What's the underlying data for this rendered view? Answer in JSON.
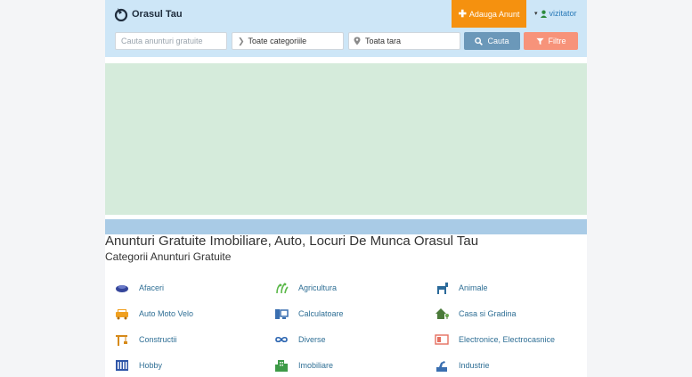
{
  "brand": {
    "name": "Orasul Tau"
  },
  "header": {
    "add_label": "Adauga Anunt",
    "user_label": "vizitator"
  },
  "search": {
    "placeholder": "Cauta anunturi gratuite",
    "category_value": "Toate categoriile",
    "location_value": "Toata tara",
    "search_label": "Cauta",
    "filter_label": "Filtre"
  },
  "main": {
    "title": "Anunturi Gratuite Imobiliare, Auto, Locuri De Munca Orasul Tau",
    "subtitle": "Categorii Anunturi Gratuite"
  },
  "categories": [
    {
      "label": "Afaceri",
      "icon": "business-icon",
      "color": "#34459a"
    },
    {
      "label": "Agricultura",
      "icon": "agriculture-icon",
      "color": "#5ab848"
    },
    {
      "label": "Animale",
      "icon": "animal-icon",
      "color": "#2b6a9a"
    },
    {
      "label": "Auto Moto Velo",
      "icon": "car-icon",
      "color": "#f0a020"
    },
    {
      "label": "Calculatoare",
      "icon": "computer-icon",
      "color": "#3a6fb0"
    },
    {
      "label": "Casa si Gradina",
      "icon": "house-icon",
      "color": "#4b7a3a"
    },
    {
      "label": "Constructii",
      "icon": "crane-icon",
      "color": "#d68a1a"
    },
    {
      "label": "Diverse",
      "icon": "infinity-icon",
      "color": "#2a64b0"
    },
    {
      "label": "Electronice, Electrocasnice",
      "icon": "appliance-icon",
      "color": "#e57060"
    },
    {
      "label": "Hobby",
      "icon": "piano-icon",
      "color": "#2f56a8"
    },
    {
      "label": "Imobiliare",
      "icon": "building-icon",
      "color": "#3d9a47"
    },
    {
      "label": "Industrie",
      "icon": "industry-icon",
      "color": "#3a6fb0"
    }
  ]
}
